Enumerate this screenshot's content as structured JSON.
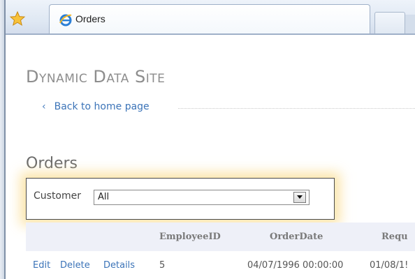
{
  "browser": {
    "tab_title": "Orders",
    "icons": {
      "favorites": "star-icon",
      "tab": "ie-logo-icon"
    }
  },
  "page": {
    "site_title": "Dynamic Data Site",
    "back_link": "Back to home page",
    "section_title": "Orders"
  },
  "filter": {
    "label": "Customer",
    "selected": "All"
  },
  "table": {
    "columns": [
      "EmployeeID",
      "OrderDate",
      "Requ"
    ],
    "rows": [
      {
        "actions": [
          "Edit",
          "Delete",
          "Details"
        ],
        "employee_id": "5",
        "order_date": "04/07/1996 00:00:00",
        "required": "01/08/1!"
      }
    ]
  },
  "colors": {
    "link": "#3c74b8",
    "title_gray": "#8d8d8d",
    "header_bg": "#eef0f8",
    "filter_glow": "#fade96"
  }
}
